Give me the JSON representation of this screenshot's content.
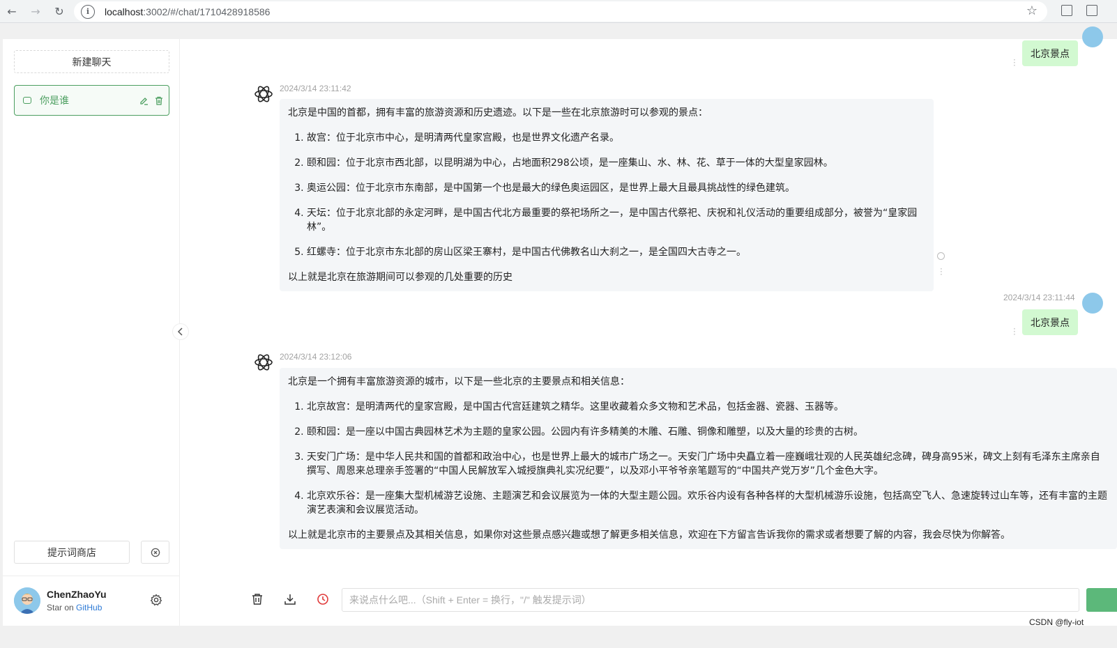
{
  "browser": {
    "url_host": "localhost",
    "url_path": ":3002/#/chat/1710428918586"
  },
  "sidebar": {
    "new_chat_label": "新建聊天",
    "chats": [
      {
        "title": "你是谁"
      }
    ],
    "prompt_store_label": "提示词商店",
    "user": {
      "name": "ChenZhaoYu",
      "star_prefix": "Star on ",
      "star_link": "GitHub"
    }
  },
  "messages": [
    {
      "role": "user",
      "text": "北京景点"
    },
    {
      "role": "assistant",
      "time": "2024/3/14 23:11:42",
      "intro": "北京是中国的首都，拥有丰富的旅游资源和历史遗迹。以下是一些在北京旅游时可以参观的景点：",
      "items": [
        "故宫：位于北京市中心，是明清两代皇家宫殿，也是世界文化遗产名录。",
        "颐和园：位于北京市西北部，以昆明湖为中心，占地面积298公顷，是一座集山、水、林、花、草于一体的大型皇家园林。",
        "奥运公园：位于北京市东南部，是中国第一个也是最大的绿色奥运园区，是世界上最大且最具挑战性的绿色建筑。",
        "天坛：位于北京北部的永定河畔，是中国古代北方最重要的祭祀场所之一，是中国古代祭祀、庆祝和礼仪活动的重要组成部分，被誉为“皇家园林”。",
        "红螺寺：位于北京市东北部的房山区梁王寨村，是中国古代佛教名山大刹之一，是全国四大古寺之一。"
      ],
      "outro": "以上就是北京在旅游期间可以参观的几处重要的历史"
    },
    {
      "role": "user",
      "time": "2024/3/14 23:11:44",
      "text": "北京景点"
    },
    {
      "role": "assistant",
      "time": "2024/3/14 23:12:06",
      "intro": "北京是一个拥有丰富旅游资源的城市，以下是一些北京的主要景点和相关信息：",
      "items": [
        "北京故宫：是明清两代的皇家宫殿，是中国古代宫廷建筑之精华。这里收藏着众多文物和艺术品，包括金器、瓷器、玉器等。",
        "颐和园：是一座以中国古典园林艺术为主题的皇家公园。公园内有许多精美的木雕、石雕、铜像和雕塑，以及大量的珍贵的古树。",
        "天安门广场：是中华人民共和国的首都和政治中心，也是世界上最大的城市广场之一。天安门广场中央矗立着一座巍峨壮观的人民英雄纪念碑，碑身高95米，碑文上刻有毛泽东主席亲自撰写、周恩来总理亲手签署的“中国人民解放军入城授旗典礼实况纪要”，以及邓小平爷爷亲笔题写的“中国共产党万岁”几个金色大字。",
        "北京欢乐谷：是一座集大型机械游艺设施、主题演艺和会议展览为一体的大型主题公园。欢乐谷内设有各种各样的大型机械游乐设施，包括高空飞人、急速旋转过山车等，还有丰富的主题演艺表演和会议展览活动。"
      ],
      "outro": "以上就是北京市的主要景点及其相关信息，如果你对这些景点感兴趣或想了解更多相关信息，欢迎在下方留言告诉我你的需求或者想要了解的内容，我会尽快为你解答。"
    }
  ],
  "input": {
    "placeholder": "来说点什么吧...（Shift + Enter = 换行，\"/\" 触发提示词）"
  },
  "watermark": "CSDN @fly-iot",
  "colors": {
    "accent": "#4b9e5f",
    "user_bubble": "#d2f9d1",
    "bot_bubble": "#f4f6f8"
  }
}
